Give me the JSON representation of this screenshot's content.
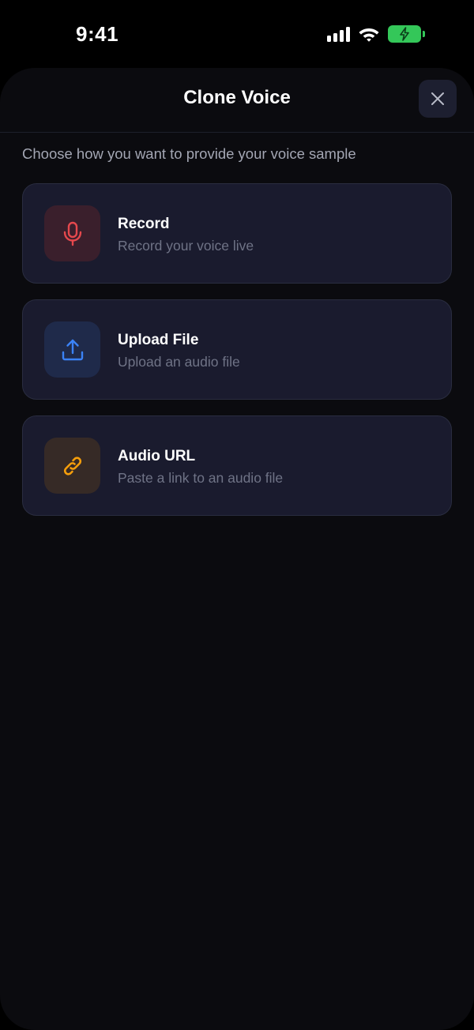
{
  "status_bar": {
    "time": "9:41"
  },
  "sheet": {
    "title": "Clone Voice",
    "subtitle": "Choose how you want to provide your voice sample"
  },
  "options": [
    {
      "title": "Record",
      "description": "Record your voice live",
      "icon": "microphone-icon",
      "icon_color": "#e5484d",
      "icon_bg": "#3a1f2c"
    },
    {
      "title": "Upload File",
      "description": "Upload an audio file",
      "icon": "upload-icon",
      "icon_color": "#3b82f6",
      "icon_bg": "#1f2a4a"
    },
    {
      "title": "Audio URL",
      "description": "Paste a link to an audio file",
      "icon": "link-icon",
      "icon_color": "#f59e0b",
      "icon_bg": "#362a26"
    }
  ],
  "colors": {
    "sheet_bg": "#0b0b0f",
    "card_bg": "#1a1b2e",
    "card_border": "#2a2d40",
    "muted_text": "#6f7386",
    "battery": "#34c759"
  }
}
